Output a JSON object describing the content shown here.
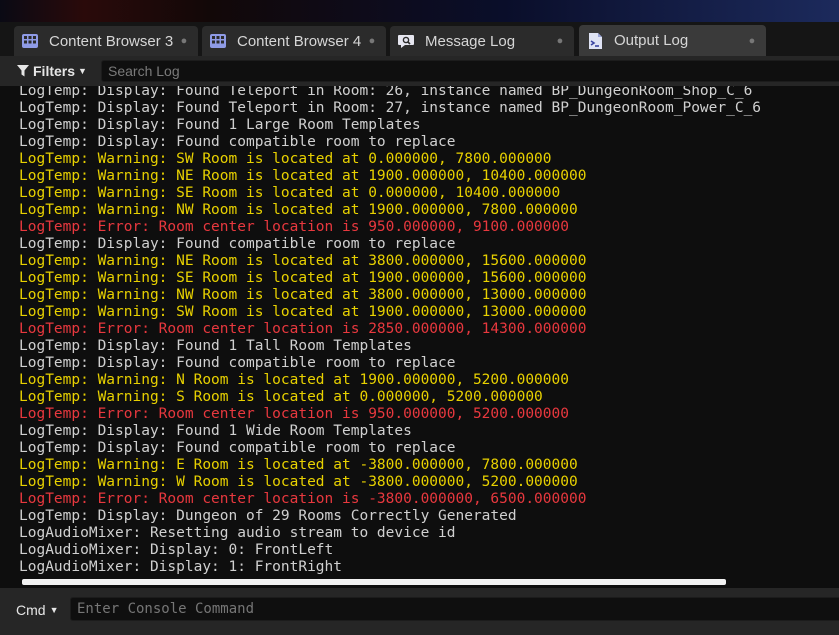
{
  "tabs": [
    {
      "label": "Content Browser 3",
      "icon": "content-browser-icon",
      "active": false
    },
    {
      "label": "Content Browser 4",
      "icon": "content-browser-icon",
      "active": false
    },
    {
      "label": "Message Log",
      "icon": "message-log-icon",
      "active": false
    },
    {
      "label": "Output Log",
      "icon": "output-log-icon",
      "active": true
    }
  ],
  "toolbar": {
    "filters_label": "Filters",
    "search_placeholder": "Search Log"
  },
  "log": {
    "lines": [
      {
        "text": "LogTemp: Display: Found Teleport in Room: 26, instance named BP_DungeonRoom_Shop_C_6",
        "level": "display"
      },
      {
        "text": "LogTemp: Display: Found Teleport in Room: 27, instance named BP_DungeonRoom_Power_C_6",
        "level": "display"
      },
      {
        "text": "LogTemp: Display: Found 1 Large Room Templates",
        "level": "display"
      },
      {
        "text": "LogTemp: Display: Found compatible room to replace",
        "level": "display"
      },
      {
        "text": "LogTemp: Warning: SW Room is located at 0.000000, 7800.000000",
        "level": "warning"
      },
      {
        "text": "LogTemp: Warning: NE Room is located at 1900.000000, 10400.000000",
        "level": "warning"
      },
      {
        "text": "LogTemp: Warning: SE Room is located at 0.000000, 10400.000000",
        "level": "warning"
      },
      {
        "text": "LogTemp: Warning: NW Room is located at 1900.000000, 7800.000000",
        "level": "warning"
      },
      {
        "text": "LogTemp: Error: Room center location is 950.000000, 9100.000000",
        "level": "error"
      },
      {
        "text": "LogTemp: Display: Found compatible room to replace",
        "level": "display"
      },
      {
        "text": "LogTemp: Warning: NE Room is located at 3800.000000, 15600.000000",
        "level": "warning"
      },
      {
        "text": "LogTemp: Warning: SE Room is located at 1900.000000, 15600.000000",
        "level": "warning"
      },
      {
        "text": "LogTemp: Warning: NW Room is located at 3800.000000, 13000.000000",
        "level": "warning"
      },
      {
        "text": "LogTemp: Warning: SW Room is located at 1900.000000, 13000.000000",
        "level": "warning"
      },
      {
        "text": "LogTemp: Error: Room center location is 2850.000000, 14300.000000",
        "level": "error"
      },
      {
        "text": "LogTemp: Display: Found 1 Tall Room Templates",
        "level": "display"
      },
      {
        "text": "LogTemp: Display: Found compatible room to replace",
        "level": "display"
      },
      {
        "text": "LogTemp: Warning: N Room is located at 1900.000000, 5200.000000",
        "level": "warning"
      },
      {
        "text": "LogTemp: Warning: S Room is located at 0.000000, 5200.000000",
        "level": "warning"
      },
      {
        "text": "LogTemp: Error: Room center location is 950.000000, 5200.000000",
        "level": "error"
      },
      {
        "text": "LogTemp: Display: Found 1 Wide Room Templates",
        "level": "display"
      },
      {
        "text": "LogTemp: Display: Found compatible room to replace",
        "level": "display"
      },
      {
        "text": "LogTemp: Warning: E Room is located at -3800.000000, 7800.000000",
        "level": "warning"
      },
      {
        "text": "LogTemp: Warning: W Room is located at -3800.000000, 5200.000000",
        "level": "warning"
      },
      {
        "text": "LogTemp: Error: Room center location is -3800.000000, 6500.000000",
        "level": "error"
      },
      {
        "text": "LogTemp: Display: Dungeon of 29 Rooms Correctly Generated",
        "level": "display"
      },
      {
        "text": "LogAudioMixer: Resetting audio stream to device id",
        "level": "display"
      },
      {
        "text": "LogAudioMixer: Display: 0: FrontLeft",
        "level": "display"
      },
      {
        "text": "LogAudioMixer: Display: 1: FrontRight",
        "level": "display"
      }
    ]
  },
  "console": {
    "cmd_label": "Cmd",
    "placeholder": "Enter Console Command"
  },
  "colors": {
    "display": "#d0d0d0",
    "warning": "#e8d100",
    "error": "#e8383e"
  }
}
